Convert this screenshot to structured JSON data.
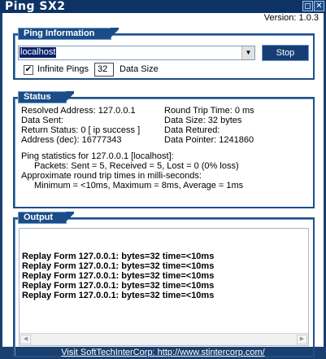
{
  "window": {
    "title": "Ping SX2",
    "max_glyph": "◻",
    "close_glyph": "✕"
  },
  "version": "Version: 1.0.3",
  "ping_info": {
    "title": "Ping Information",
    "host_value": "localhost",
    "stop_label": "Stop",
    "infinite_label": "Infinite Pings",
    "infinite_checked": true,
    "data_size_value": "32",
    "data_size_label": "Data Size"
  },
  "status": {
    "title": "Status",
    "left": [
      "Resolved Address: 127.0.0.1",
      "Data Sent:",
      "Return Status: 0   [ ip success ]",
      "Address (dec): 16777343"
    ],
    "right": [
      "Round Trip Time: 0 ms",
      "Data Size: 32 bytes",
      "Data Retured:",
      "Data Pointer: 1241860"
    ],
    "stats": [
      "Ping statistics for 127.0.0.1 [localhost]:",
      "Packets: Sent = 5, Received = 5, Lost = 0 (0% loss)",
      "Approximate round trip times in milli-seconds:",
      "Minimum = <10ms, Maximum =  8ms, Average =  1ms"
    ]
  },
  "output": {
    "title": "Output",
    "lines": [
      "Replay Form 127.0.0.1: bytes=32 time=<10ms",
      "Replay Form 127.0.0.1: bytes=32 time=<10ms",
      "Replay Form 127.0.0.1: bytes=32 time=<10ms",
      "Replay Form 127.0.0.1: bytes=32 time=<10ms",
      "Replay Form 127.0.0.1: bytes=32 time=<10ms"
    ]
  },
  "footer_link": "Visit SoftTechInterCorp: http://www.stintercorp.com/",
  "colors": {
    "frame": "#1b3f6e",
    "titlebar": "#0d3266",
    "group_border": "#1e4f8c",
    "accent": "#163e74"
  },
  "icons": {
    "dropdown": "chevron-down-icon",
    "scroll_left": "arrow-left-icon",
    "scroll_right": "arrow-right-icon"
  }
}
